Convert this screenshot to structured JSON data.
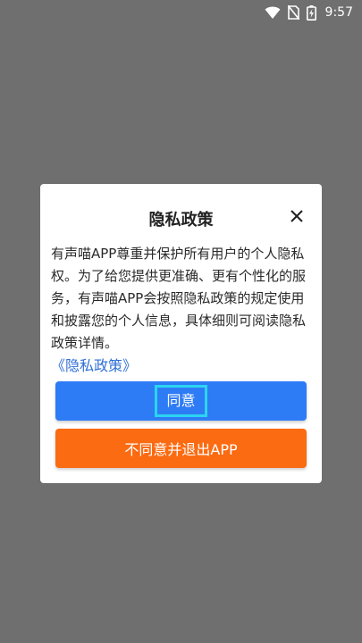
{
  "status_bar": {
    "time": "9:57",
    "icons": [
      "wifi-icon",
      "no-sim-icon",
      "battery-charging-icon"
    ]
  },
  "dialog": {
    "title": "隐私政策",
    "close_icon": "close-icon",
    "body": "有声喵APP尊重并保护所有用户的个人隐私权。为了给您提供更准确、更有个性化的服务，有声喵APP会按照隐私政策的规定使用和披露您的个人信息，具体细则可阅读隐私政策详情。",
    "policy_link": "《隐私政策》",
    "agree_label": "同意",
    "disagree_label": "不同意并退出APP"
  },
  "colors": {
    "overlay": "#6f6f6f",
    "agree_button": "#2e7bf6",
    "disagree_button": "#fb6b12",
    "link": "#2f6fd6",
    "focus_outline": "#2bd5f0"
  }
}
